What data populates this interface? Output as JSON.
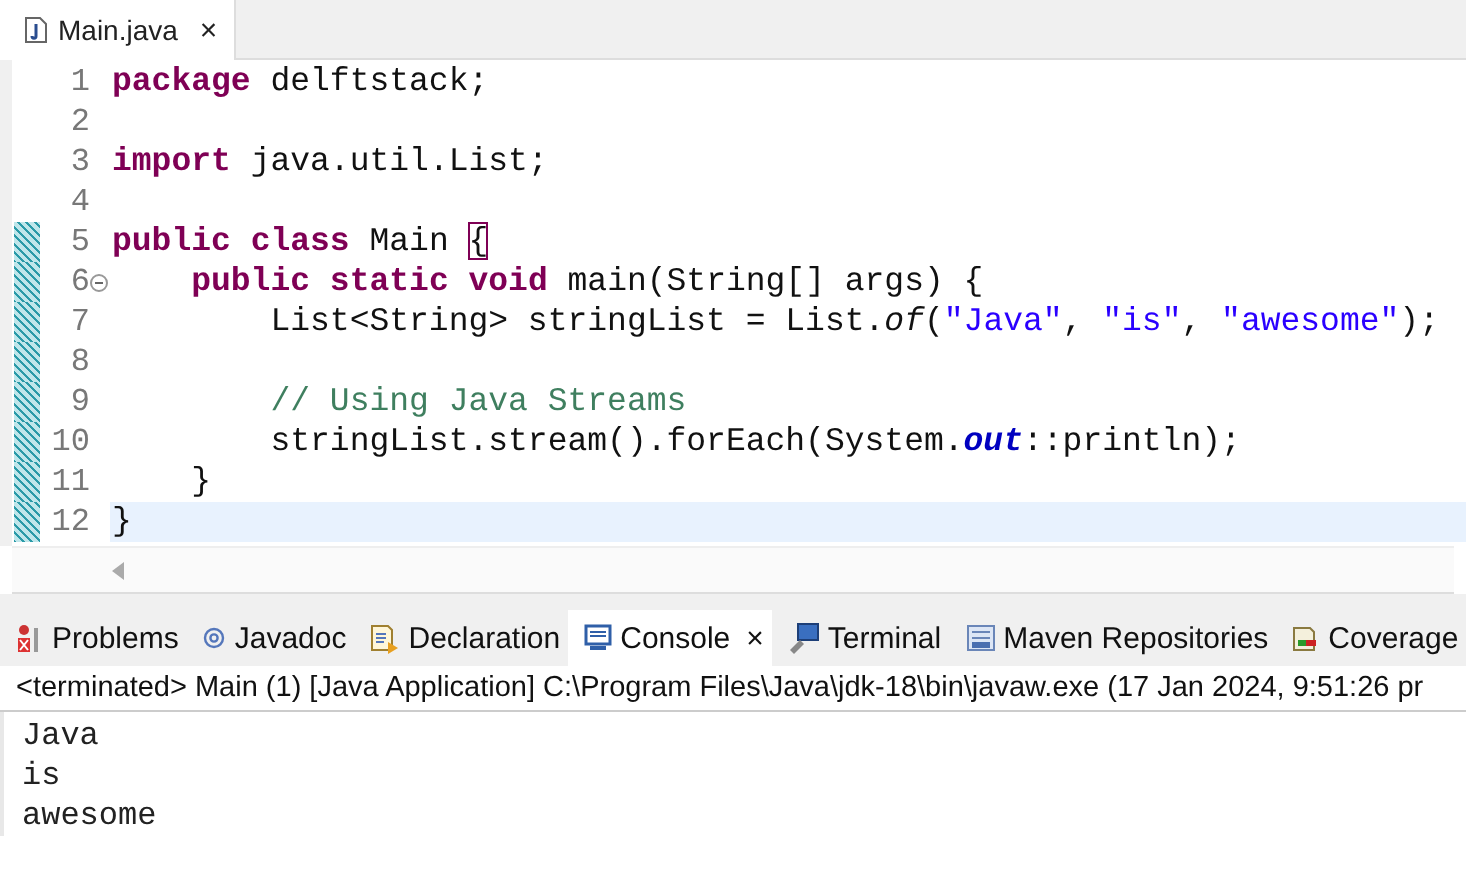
{
  "editor_tab": {
    "title": "Main.java",
    "close": "×"
  },
  "code_lines": [
    {
      "number": "1",
      "changed": false,
      "current": false,
      "fold": false,
      "tokens": [
        {
          "kind": "keyword",
          "text": "package"
        },
        {
          "kind": "plain",
          "text": " delftstack;"
        }
      ]
    },
    {
      "number": "2",
      "changed": false,
      "current": false,
      "fold": false
    },
    {
      "number": "3",
      "changed": false,
      "current": false,
      "fold": false,
      "tokens": [
        {
          "kind": "keyword",
          "text": "import"
        },
        {
          "kind": "plain",
          "text": " java.util.List;"
        }
      ]
    },
    {
      "number": "4",
      "changed": false,
      "current": false,
      "fold": false
    },
    {
      "number": "5",
      "changed": true,
      "current": false,
      "fold": false,
      "tokens": [
        {
          "kind": "keyword",
          "text": "public"
        },
        {
          "kind": "keyword",
          "text": " class"
        },
        {
          "kind": "plain",
          "text": " Main "
        },
        {
          "kind": "bracket",
          "text": "{"
        }
      ]
    },
    {
      "number": "6",
      "changed": true,
      "current": false,
      "fold": true,
      "tokens": [
        {
          "kind": "keyword",
          "text": "    public"
        },
        {
          "kind": "keyword",
          "text": " static"
        },
        {
          "kind": "keyword",
          "text": " void"
        },
        {
          "kind": "plain",
          "text": " main(String[] args) {"
        }
      ]
    },
    {
      "number": "7",
      "changed": true,
      "current": false,
      "fold": false,
      "tokens": [
        {
          "kind": "plain",
          "text": "        List<String> stringList = List."
        },
        {
          "kind": "static-method",
          "text": "of"
        },
        {
          "kind": "plain",
          "text": "("
        },
        {
          "kind": "string",
          "text": "\"Java\""
        },
        {
          "kind": "plain",
          "text": ", "
        },
        {
          "kind": "string",
          "text": "\"is\""
        },
        {
          "kind": "plain",
          "text": ", "
        },
        {
          "kind": "string",
          "text": "\"awesome\""
        },
        {
          "kind": "plain",
          "text": ");"
        }
      ]
    },
    {
      "number": "8",
      "changed": true,
      "current": false,
      "fold": false
    },
    {
      "number": "9",
      "changed": true,
      "current": false,
      "fold": false,
      "tokens": [
        {
          "kind": "comment",
          "text": "        // Using Java Streams"
        }
      ]
    },
    {
      "number": "10",
      "changed": true,
      "current": false,
      "fold": false,
      "tokens": [
        {
          "kind": "plain",
          "text": "        stringList.stream().forEach(System."
        },
        {
          "kind": "static-field",
          "text": "out"
        },
        {
          "kind": "plain",
          "text": "::println);"
        }
      ]
    },
    {
      "number": "11",
      "changed": true,
      "current": false,
      "fold": false,
      "tokens": [
        {
          "kind": "plain",
          "text": "    }"
        }
      ]
    },
    {
      "number": "12",
      "changed": true,
      "current": true,
      "fold": false,
      "tokens": [
        {
          "kind": "plain",
          "text": "}"
        }
      ]
    }
  ],
  "view_tabs": [
    {
      "label": "Problems",
      "selected": false
    },
    {
      "label": "Javadoc",
      "selected": false
    },
    {
      "label": "Declaration",
      "selected": false
    },
    {
      "label": "Console",
      "selected": true,
      "close": "×"
    },
    {
      "label": "Terminal",
      "selected": false
    },
    {
      "label": "Maven Repositories",
      "selected": false
    },
    {
      "label": "Coverage",
      "selected": false
    }
  ],
  "console": {
    "header": "<terminated> Main (1) [Java Application] C:\\Program Files\\Java\\jdk-18\\bin\\javaw.exe  (17 Jan 2024, 9:51:26 pr",
    "output": [
      "Java",
      "is",
      "awesome"
    ]
  }
}
